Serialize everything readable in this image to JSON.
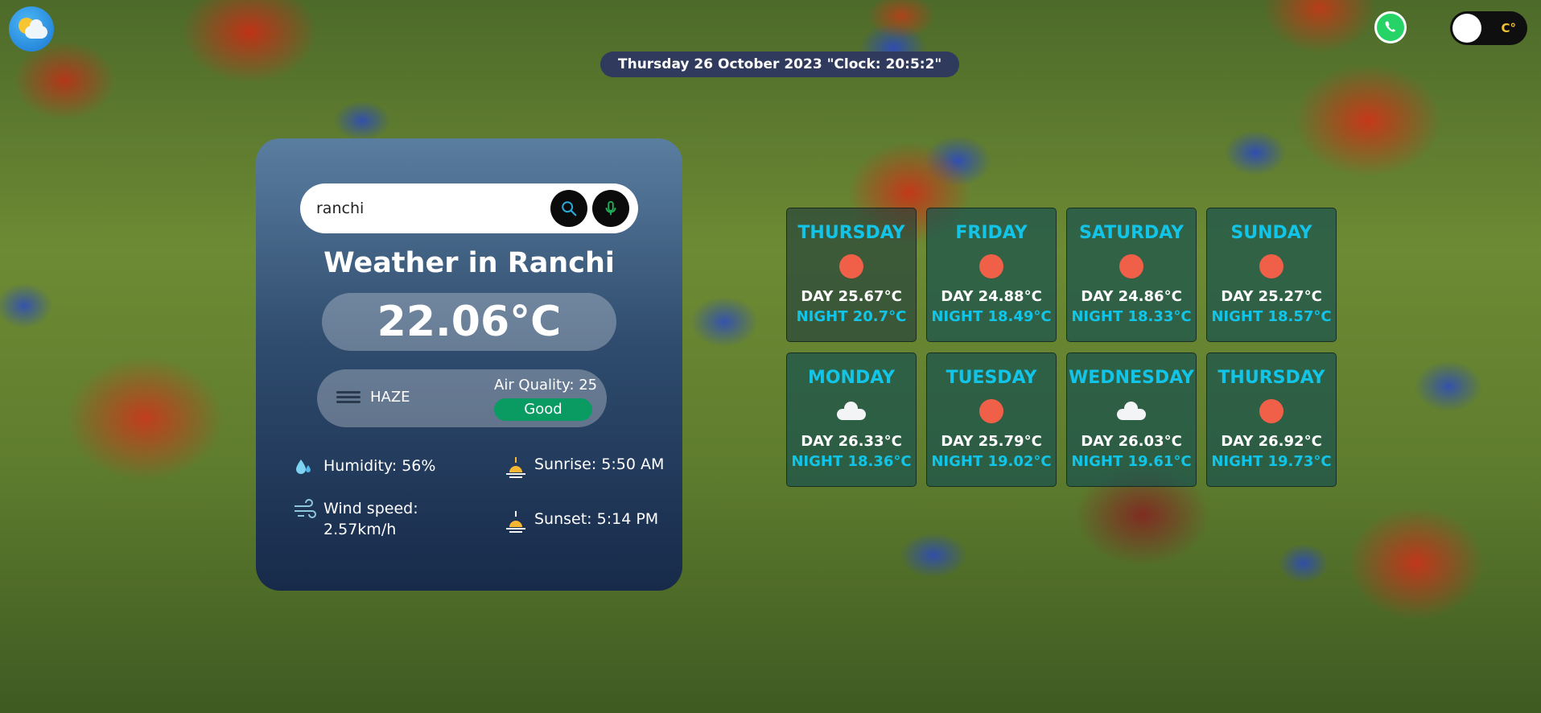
{
  "header": {
    "logo_icon": "weather-logo-icon",
    "datetime": "Thursday 26 October 2023 \"Clock: 20:5:2\"",
    "whatsapp_icon": "whatsapp-icon",
    "unit_toggle_label": "C°"
  },
  "weather_card": {
    "search_value": "ranchi",
    "search_icon": "search-icon",
    "mic_icon": "microphone-icon",
    "title": "Weather in Ranchi",
    "temperature": "22.06°C",
    "condition": "HAZE",
    "air_quality_label": "Air Quality: 25",
    "air_quality_status": "Good",
    "humidity": "Humidity: 56%",
    "wind_label": "Wind speed:",
    "wind_value": "2.57km/h",
    "sunrise": "Sunrise: 5:50 AM",
    "sunset": "Sunset: 5:14 PM"
  },
  "forecast": [
    {
      "day": "THURSDAY",
      "icon": "sun",
      "day_temp": "DAY 25.67°C",
      "night_temp": "NIGHT 20.7°C"
    },
    {
      "day": "FRIDAY",
      "icon": "sun",
      "day_temp": "DAY 24.88°C",
      "night_temp": "NIGHT 18.49°C"
    },
    {
      "day": "SATURDAY",
      "icon": "sun",
      "day_temp": "DAY 24.86°C",
      "night_temp": "NIGHT 18.33°C"
    },
    {
      "day": "SUNDAY",
      "icon": "sun",
      "day_temp": "DAY 25.27°C",
      "night_temp": "NIGHT 18.57°C"
    },
    {
      "day": "MONDAY",
      "icon": "cloud",
      "day_temp": "DAY 26.33°C",
      "night_temp": "NIGHT 18.36°C"
    },
    {
      "day": "TUESDAY",
      "icon": "sun",
      "day_temp": "DAY 25.79°C",
      "night_temp": "NIGHT 19.02°C"
    },
    {
      "day": "WEDNESDAY",
      "icon": "cloud",
      "day_temp": "DAY 26.03°C",
      "night_temp": "NIGHT 19.61°C"
    },
    {
      "day": "THURSDAY",
      "icon": "sun",
      "day_temp": "DAY 26.92°C",
      "night_temp": "NIGHT 19.73°C"
    }
  ],
  "colors": {
    "accent_cyan": "#12c5e8",
    "air_quality_good": "#0a9b63",
    "sun_icon": "#f06048"
  }
}
